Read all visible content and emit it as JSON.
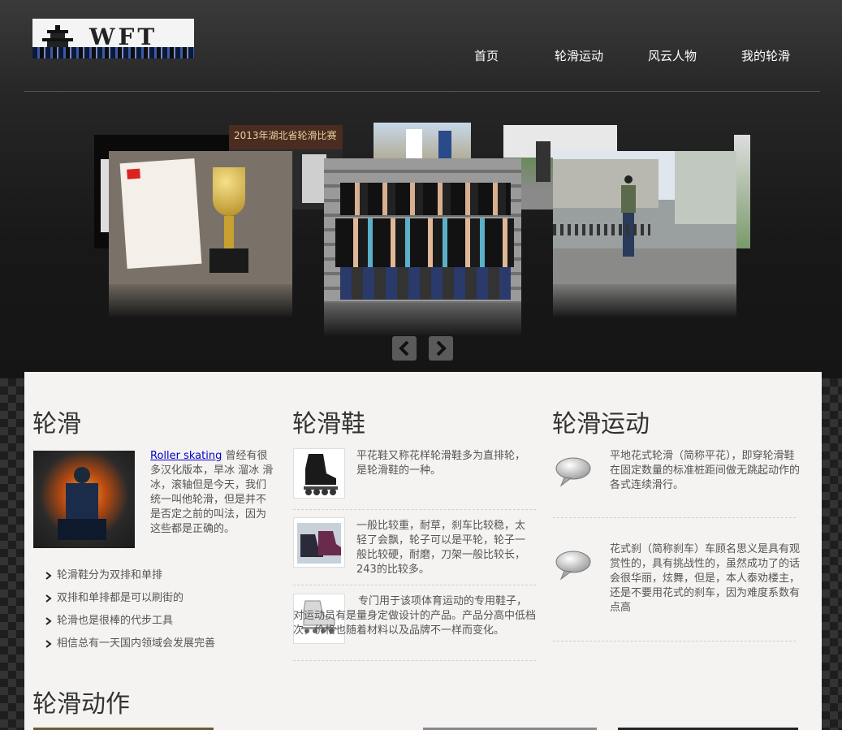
{
  "header": {
    "logo_text": "WFT",
    "nav": [
      {
        "label": "首页"
      },
      {
        "label": "轮滑运动"
      },
      {
        "label": "风云人物"
      },
      {
        "label": "我的轮滑"
      }
    ]
  },
  "carousel": {
    "banner_text": "2013年湖北省轮滑比赛",
    "prev_icon": "chevron-left-icon",
    "next_icon": "chevron-right-icon"
  },
  "sections": {
    "skating": {
      "title": "轮滑",
      "link_text": "Roller skating",
      "intro": " 曾经有很多汉化版本，旱冰 溜冰 滑冰，滚轴但是今天，我们统一叫他轮滑，但是并不是否定之前的叫法，因为这些都是正确的。",
      "bullets": [
        "轮滑鞋分为双排和单排",
        "双排和单排都是可以刷街的",
        "轮滑也是很棒的代步工具",
        "相信总有一天国内领域会发展完善"
      ]
    },
    "shoes": {
      "title": "轮滑鞋",
      "items": [
        {
          "text": "平花鞋又称花样轮滑鞋多为直排轮，是轮滑鞋的一种。"
        },
        {
          "text": "一般比较重，耐草，刹车比较稳，太轻了会飘，轮子可以是平轮，轮子一般比较硬，耐磨，刀架一般比较长，243的比较多。"
        },
        {
          "text": "专门用于该项体育运动的专用鞋子，对运动员有是量身定做设计的产品。产品分高中低档次，价格也随着材料以及品牌不一样而变化。"
        }
      ]
    },
    "sport": {
      "title": "轮滑运动",
      "items": [
        {
          "text": "平地花式轮滑（简称平花），即穿轮滑鞋在固定数量的标准桩距间做无跳起动作的各式连续滑行。"
        },
        {
          "text": "花式刹（简称刹车）车顾名思义是具有观赏性的，具有挑战性的，虽然成功了的话会很华丽，炫舞，但是，本人泰劝楼主，还是不要用花式的刹车，因为难度系数有点高"
        }
      ]
    },
    "moves": {
      "title": "轮滑动作"
    }
  },
  "colors": {
    "panel": "#f4f3f1",
    "link": "#0000cc",
    "nav_text": "#ffffff",
    "title": "#333333"
  }
}
